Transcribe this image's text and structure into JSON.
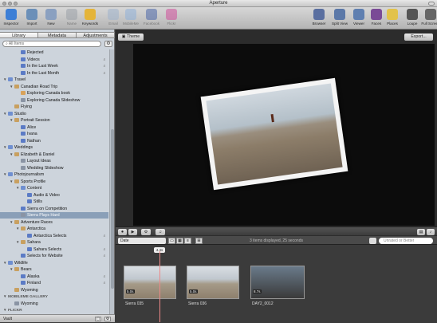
{
  "window": {
    "title": "Aperture"
  },
  "toolbar": {
    "left": [
      {
        "label": "Inspector",
        "icon": "info-icon",
        "color": "#3d7fd6"
      },
      {
        "label": "Import",
        "icon": "import-icon",
        "color": "#6b8fb8"
      },
      {
        "label": "New",
        "icon": "new-icon",
        "color": "#8aa0c0"
      },
      {
        "label": "Name",
        "icon": "name-icon",
        "color": "#9aa0a8"
      },
      {
        "label": "Keywords",
        "icon": "keywords-icon",
        "color": "#e4b43a"
      },
      {
        "label": "Email",
        "icon": "email-icon",
        "color": "#9fb3cc"
      },
      {
        "label": "MobileMe",
        "icon": "mobileme-icon",
        "color": "#8fb0d8"
      },
      {
        "label": "Facebook",
        "icon": "facebook-icon",
        "color": "#4a66a8"
      },
      {
        "label": "Flickr",
        "icon": "flickr-icon",
        "color": "#d04e9a"
      }
    ],
    "right": [
      {
        "label": "Browser",
        "icon": "browser-icon",
        "color": "#5a6fa0"
      },
      {
        "label": "Split View",
        "icon": "split-view-icon",
        "color": "#5b78a8"
      },
      {
        "label": "Viewer",
        "icon": "viewer-icon",
        "color": "#5f7fb0"
      },
      {
        "label": "Faces",
        "icon": "faces-icon",
        "color": "#7a4a96"
      },
      {
        "label": "Places",
        "icon": "places-icon",
        "color": "#e2c24a"
      },
      {
        "label": "Loupe",
        "icon": "loupe-icon",
        "color": "#555555"
      },
      {
        "label": "Full Screen",
        "icon": "full-screen-icon",
        "color": "#666666"
      }
    ]
  },
  "sidebar": {
    "tabs": [
      "Library",
      "Metadata",
      "Adjustments"
    ],
    "search_placeholder": "All Items",
    "items": [
      {
        "label": "Rejected",
        "type": "album",
        "depth": 2,
        "count": ""
      },
      {
        "label": "Videos",
        "type": "album",
        "depth": 2,
        "count": "4"
      },
      {
        "label": "In the Last Week",
        "type": "album",
        "depth": 2,
        "count": "4"
      },
      {
        "label": "In the Last Month",
        "type": "album",
        "depth": 2,
        "count": "4"
      },
      {
        "label": "Travel",
        "type": "folder",
        "depth": 0,
        "tri": "▼",
        "count": ""
      },
      {
        "label": "Canadian Road Trip",
        "type": "proj",
        "depth": 1,
        "tri": "▼",
        "count": ""
      },
      {
        "label": "Exploring Canada book",
        "type": "book",
        "depth": 2,
        "count": ""
      },
      {
        "label": "Exploring Canada Slideshow",
        "type": "show",
        "depth": 2,
        "count": ""
      },
      {
        "label": "Flying",
        "type": "proj",
        "depth": 1,
        "count": ""
      },
      {
        "label": "Studio",
        "type": "folder",
        "depth": 0,
        "tri": "▼",
        "count": ""
      },
      {
        "label": "Portrait Session",
        "type": "proj",
        "depth": 1,
        "tri": "▼",
        "count": ""
      },
      {
        "label": "Alice",
        "type": "album",
        "depth": 2,
        "count": ""
      },
      {
        "label": "Ivana",
        "type": "album",
        "depth": 2,
        "count": ""
      },
      {
        "label": "Nathan",
        "type": "album",
        "depth": 2,
        "count": ""
      },
      {
        "label": "Weddings",
        "type": "folder",
        "depth": 0,
        "tri": "▼",
        "count": ""
      },
      {
        "label": "Elizabeth & Daniel",
        "type": "proj",
        "depth": 1,
        "tri": "▼",
        "count": ""
      },
      {
        "label": "Layout Ideas",
        "type": "show",
        "depth": 2,
        "count": ""
      },
      {
        "label": "Wedding Slideshow",
        "type": "show",
        "depth": 2,
        "count": ""
      },
      {
        "label": "Photojournalism",
        "type": "folder",
        "depth": 0,
        "tri": "▼",
        "count": ""
      },
      {
        "label": "Sports Profile",
        "type": "proj",
        "depth": 1,
        "tri": "▼",
        "count": ""
      },
      {
        "label": "Content",
        "type": "folder",
        "depth": 2,
        "tri": "▼",
        "count": ""
      },
      {
        "label": "Audio & Video",
        "type": "album",
        "depth": 3,
        "count": ""
      },
      {
        "label": "Stills",
        "type": "album",
        "depth": 3,
        "count": ""
      },
      {
        "label": "Sierra on Competition",
        "type": "album",
        "depth": 2,
        "count": ""
      },
      {
        "label": "Sierra Plays Hard",
        "type": "show",
        "depth": 2,
        "count": "",
        "selected": true
      },
      {
        "label": "Adventure Races",
        "type": "proj",
        "depth": 1,
        "tri": "▼",
        "count": ""
      },
      {
        "label": "Antarctica",
        "type": "proj",
        "depth": 2,
        "tri": "▼",
        "count": ""
      },
      {
        "label": "Antarctica Selects",
        "type": "album",
        "depth": 3,
        "count": "4"
      },
      {
        "label": "Sahara",
        "type": "proj",
        "depth": 2,
        "tri": "▼",
        "count": ""
      },
      {
        "label": "Sahara Selects",
        "type": "album",
        "depth": 3,
        "count": "4"
      },
      {
        "label": "Selects for Website",
        "type": "album",
        "depth": 2,
        "count": "4"
      },
      {
        "label": "Wildlife",
        "type": "folder",
        "depth": 0,
        "tri": "▼",
        "count": ""
      },
      {
        "label": "Bears",
        "type": "proj",
        "depth": 1,
        "tri": "▼",
        "count": ""
      },
      {
        "label": "Alaska",
        "type": "album",
        "depth": 2,
        "count": "4"
      },
      {
        "label": "Finland",
        "type": "album",
        "depth": 2,
        "count": "4"
      },
      {
        "label": "Wyoming",
        "type": "proj",
        "depth": 1,
        "count": ""
      },
      {
        "label": "MOBILEME GALLERY",
        "type": "section",
        "depth": 0,
        "tri": "▼",
        "count": ""
      },
      {
        "label": "Wyoming",
        "type": "show",
        "depth": 1,
        "count": ""
      },
      {
        "label": "FLICKR",
        "type": "section",
        "depth": 0,
        "tri": "▼",
        "count": ""
      }
    ],
    "footer_label": "Vault"
  },
  "viewer": {
    "theme_label": "Theme",
    "export_label": "Export..."
  },
  "controls": {
    "sort_label": "Date",
    "status": "3 items displayed, 25 seconds",
    "filter_placeholder": "Unrated or Better",
    "playhead_label": "4.4s"
  },
  "clips": [
    {
      "name": "Sierra 035",
      "duration": "5.0s"
    },
    {
      "name": "Sierra 036",
      "duration": "5.0s"
    },
    {
      "name": "DAY2_0012",
      "duration": "8.7s"
    }
  ]
}
